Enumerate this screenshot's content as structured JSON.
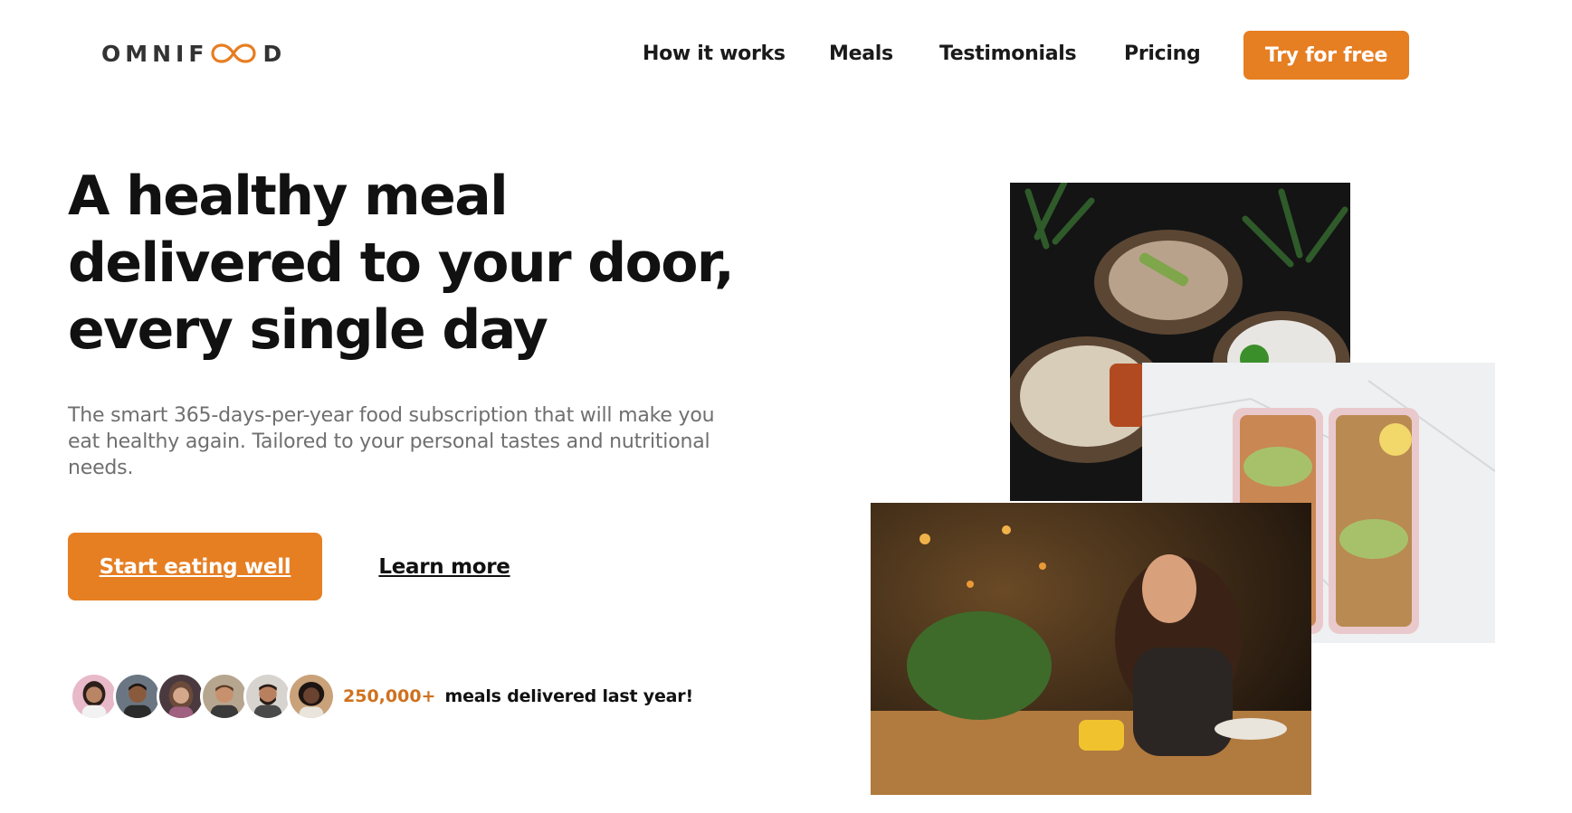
{
  "brand": {
    "name_part1": "OMNIF",
    "name_part2": "D",
    "accent_color": "#e67e22"
  },
  "nav": {
    "links": [
      "How it works",
      "Meals",
      "Testimonials",
      "Pricing"
    ],
    "cta_label": "Try for free"
  },
  "hero": {
    "title": "A healthy meal delivered to your door, every single day",
    "description": "The smart 365-days-per-year food subscription that will make you eat healthy again. Tailored to your personal tastes and nutritional needs.",
    "primary_button": "Start eating well",
    "secondary_button": "Learn more",
    "meals_count": "250,000+",
    "meals_text": "meals delivered last year!"
  },
  "icons": {
    "logo": "infinity-icon"
  }
}
